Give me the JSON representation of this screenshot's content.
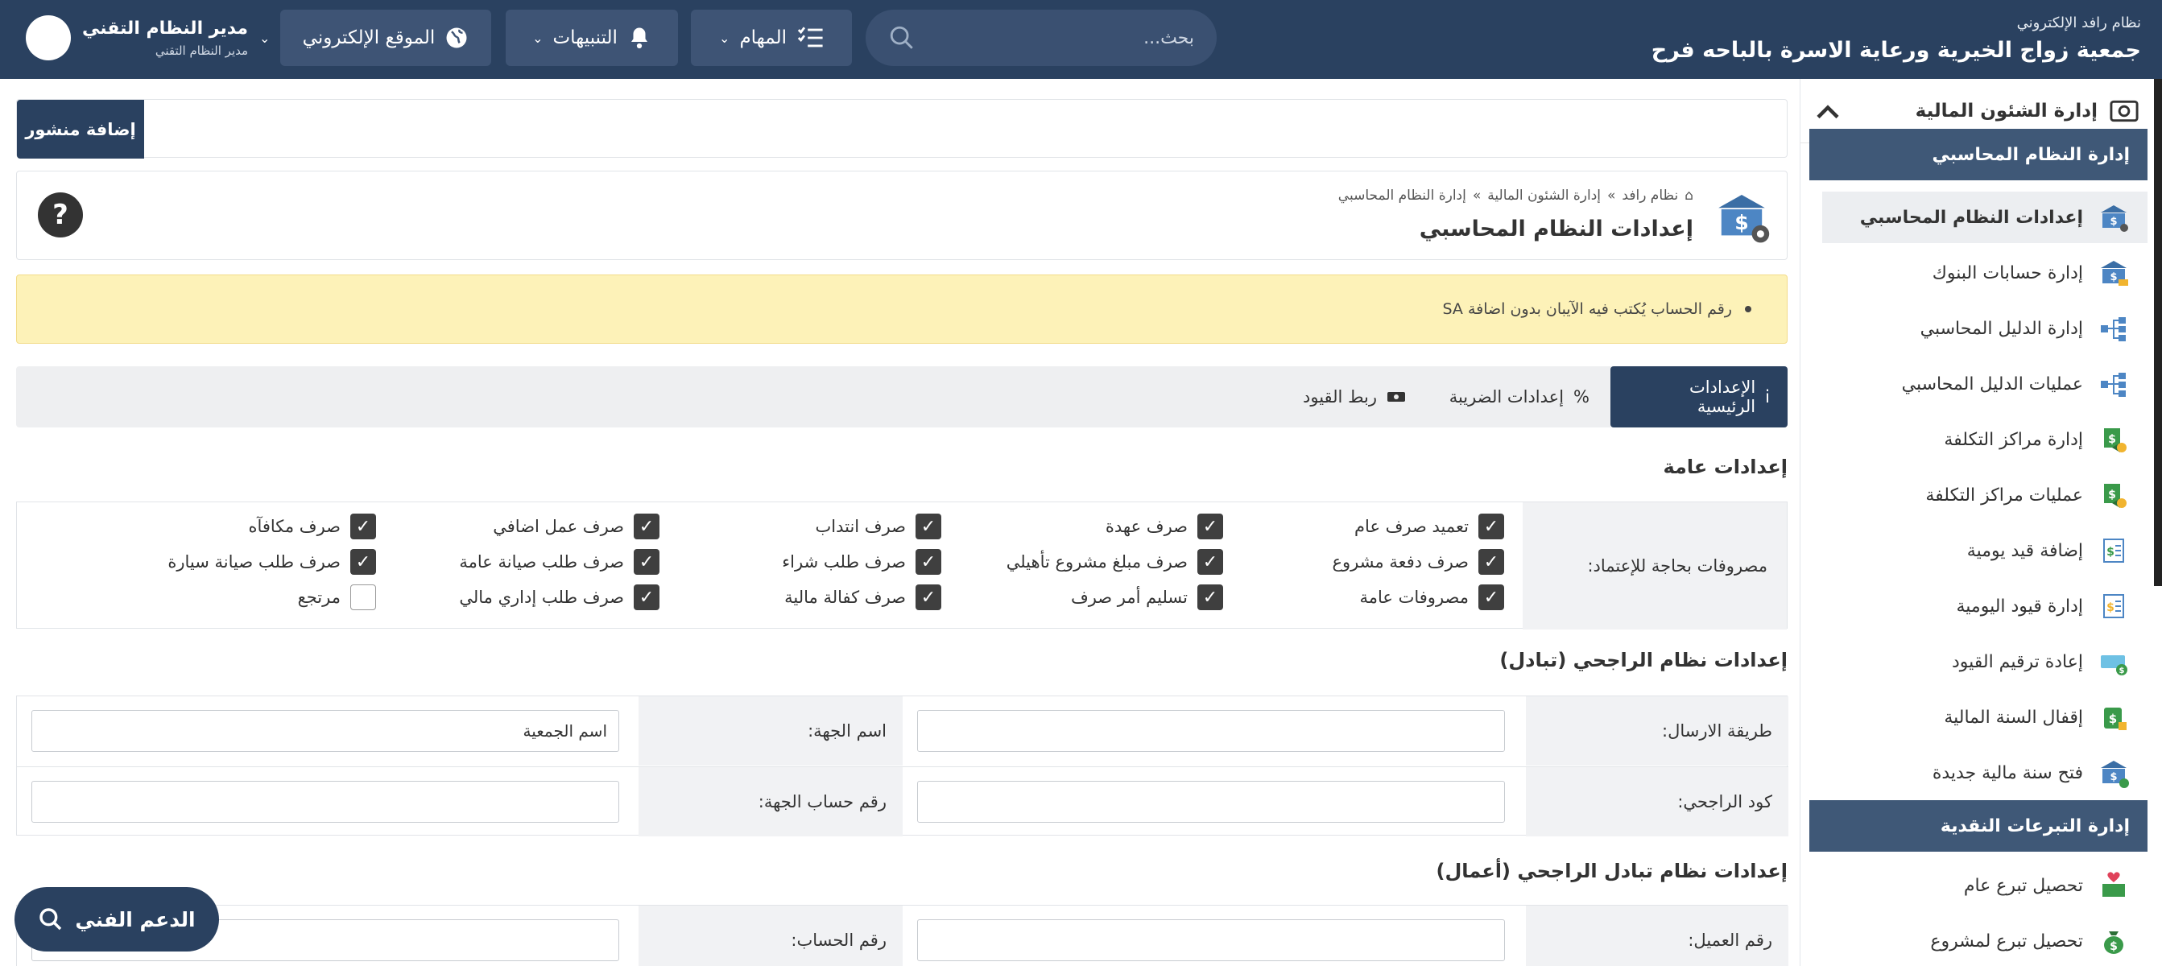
{
  "header": {
    "system_name": "نظام رافد الإلكتروني",
    "org_name": "جمعية زواج الخيرية ورعاية الاسرة بالباحه فرح",
    "search_placeholder": "بحث...",
    "tasks_label": "المهام",
    "notifications_label": "التنبيهات",
    "website_label": "الموقع الإلكتروني",
    "user_name": "مدير النظام التقني",
    "user_role": "مدير النظام التقني"
  },
  "sidebar": {
    "module_title": "إدارة الشئون المالية",
    "sections": [
      {
        "title": "إدارة النظام المحاسبي",
        "items": [
          {
            "label": "إعدادات النظام المحاسبي",
            "icon": "bank-settings-icon"
          },
          {
            "label": "إدارة حسابات البنوك",
            "icon": "bank-accounts-icon"
          },
          {
            "label": "إدارة الدليل المحاسبي",
            "icon": "tree-icon"
          },
          {
            "label": "عمليات الدليل المحاسبي",
            "icon": "tree-icon"
          },
          {
            "label": "إدارة مراكز التكلفة",
            "icon": "cost-center-icon"
          },
          {
            "label": "عمليات مراكز التكلفة",
            "icon": "cost-center-icon"
          },
          {
            "label": "إضافة قيد يومية",
            "icon": "journal-add-icon"
          },
          {
            "label": "إدارة قيود اليومية",
            "icon": "journal-icon"
          },
          {
            "label": "إعادة ترقيم القيود",
            "icon": "renumber-icon"
          },
          {
            "label": "إقفال السنة المالية",
            "icon": "lock-year-icon"
          },
          {
            "label": "فتح سنة مالية جديدة",
            "icon": "new-year-icon"
          }
        ]
      },
      {
        "title": "إدارة التبرعات النقدية",
        "items": [
          {
            "label": "تحصيل تبرع عام",
            "icon": "donation-icon"
          },
          {
            "label": "تحصيل تبرع لمشروع",
            "icon": "money-bag-icon"
          }
        ]
      }
    ]
  },
  "main": {
    "add_post_label": "إضافة منشور",
    "breadcrumb": [
      "نظام رافد",
      "إدارة الشئون المالية",
      "إدارة النظام المحاسبي"
    ],
    "breadcrumb_sep": "»",
    "page_title": "إعدادات النظام المحاسبي",
    "help_label": "?",
    "alert_text": "رقم الحساب يُكتب فيه الآيبان بدون اضافة SA",
    "tabs": [
      {
        "label": "الإعدادات الرئيسية",
        "icon": "i"
      },
      {
        "label": "إعدادات الضريبة",
        "icon": "%"
      },
      {
        "label": "ربط القيود",
        "icon": "money-icon"
      }
    ],
    "general_settings_title": "إعدادات عامة",
    "expenses_label": "مصروفات بحاجة للإعتماد:",
    "expense_checkboxes": [
      [
        "تعميد صرف عام",
        "صرف عهدة",
        "صرف انتداب",
        "صرف عمل اضافي",
        "صرف مكافآه"
      ],
      [
        "صرف دفعة مشروع",
        "صرف مبلغ مشروع تأهيلي",
        "صرف طلب شراء",
        "صرف طلب صيانة عامة",
        "صرف طلب صيانة سيارة"
      ],
      [
        "مصروفات عامة",
        "تسليم أمر صرف",
        "صرف كفالة مالية",
        "صرف طلب إداري مالي",
        "مرتجع"
      ]
    ],
    "expense_checked": [
      [
        true,
        true,
        true,
        true,
        true
      ],
      [
        true,
        true,
        true,
        true,
        true
      ],
      [
        true,
        true,
        true,
        true,
        false
      ]
    ],
    "rajhi_title": "إعدادات نظام الراجحي (تبادل)",
    "rajhi_fields": {
      "send_method_label": "طريقة الارسال:",
      "send_method_value": "",
      "entity_name_label": "اسم الجهة:",
      "entity_name_value": "اسم الجمعية",
      "rajhi_code_label": "كود الراجحي:",
      "rajhi_code_value": "",
      "entity_account_label": "رقم حساب الجهة:",
      "entity_account_value": ""
    },
    "rajhi_business_title": "إعدادات نظام تبادل الراجحي (أعمال)",
    "rajhi_business_fields": {
      "client_number_label": "رقم العميل:",
      "client_number_value": "",
      "account_number_label": "رقم الحساب:",
      "account_number_value": ""
    },
    "support_label": "الدعم الفني"
  },
  "colors": {
    "primary": "#2a4160",
    "section_header": "#3f5877",
    "alert_bg": "#fdf2b8",
    "checkbox": "#3f3f3f"
  }
}
